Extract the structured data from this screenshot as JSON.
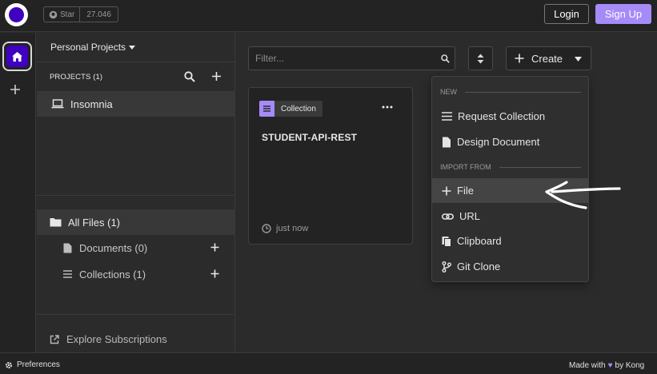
{
  "colors": {
    "accent": "#a58bf7",
    "brand": "#4000bf",
    "bg": "#2b2b2b",
    "surface": "#232323",
    "highlight": "#444444"
  },
  "header": {
    "logo_icon": "insomnia-logo-icon",
    "github_star_label": "Star",
    "github_star_count": "27.046",
    "login_label": "Login",
    "signup_label": "Sign Up"
  },
  "rail": {
    "home_icon": "home-icon",
    "add_icon": "plus-icon"
  },
  "sidebar": {
    "org_name": "Personal Projects",
    "projects_title": "PROJECTS (1)",
    "projects": [
      {
        "label": "Insomnia",
        "icon": "laptop-icon"
      }
    ],
    "all_files": "All Files (1)",
    "sub_items": [
      {
        "label": "Documents (0)",
        "icon": "document-icon"
      },
      {
        "label": "Collections (1)",
        "icon": "list-icon"
      }
    ],
    "explore_label": "Explore Subscriptions"
  },
  "toolbar": {
    "filter_placeholder": "Filter...",
    "create_label": "Create"
  },
  "card": {
    "badge": "Collection",
    "title": "STUDENT-API-REST",
    "time": "just now"
  },
  "dropdown": {
    "section_new": "NEW",
    "new_items": [
      {
        "label": "Request Collection",
        "icon": "list-icon"
      },
      {
        "label": "Design Document",
        "icon": "document-icon"
      }
    ],
    "section_import": "IMPORT FROM",
    "import_items": [
      {
        "label": "File",
        "icon": "plus-icon",
        "highlighted": true
      },
      {
        "label": "URL",
        "icon": "link-icon"
      },
      {
        "label": "Clipboard",
        "icon": "clipboard-icon"
      },
      {
        "label": "Git Clone",
        "icon": "git-branch-icon"
      }
    ]
  },
  "footer": {
    "preferences_label": "Preferences",
    "made_with_prefix": "Made with",
    "made_with_suffix": "by Kong"
  }
}
